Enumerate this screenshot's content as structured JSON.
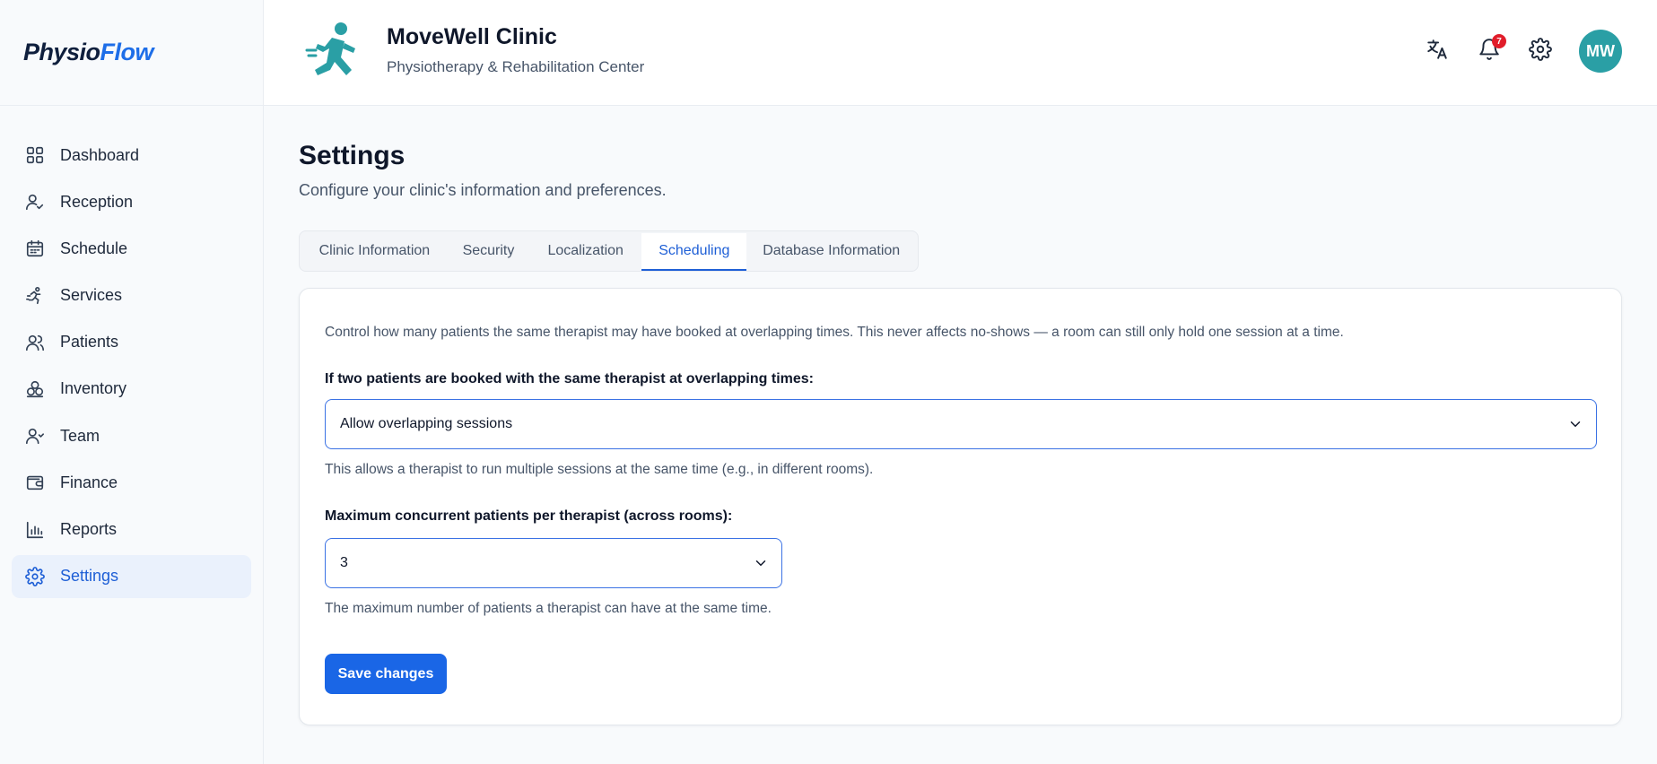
{
  "app": {
    "logo_part1": "Physio",
    "logo_part2": "Flow"
  },
  "sidebar": {
    "items": [
      {
        "label": "Dashboard",
        "icon": "grid-icon"
      },
      {
        "label": "Reception",
        "icon": "user-check-icon"
      },
      {
        "label": "Schedule",
        "icon": "calendar-icon"
      },
      {
        "label": "Services",
        "icon": "running-person-icon"
      },
      {
        "label": "Patients",
        "icon": "users-icon"
      },
      {
        "label": "Inventory",
        "icon": "boxes-icon"
      },
      {
        "label": "Team",
        "icon": "team-icon"
      },
      {
        "label": "Finance",
        "icon": "wallet-icon"
      },
      {
        "label": "Reports",
        "icon": "bar-chart-icon"
      },
      {
        "label": "Settings",
        "icon": "gear-icon",
        "active": true
      }
    ]
  },
  "header": {
    "clinic_name": "MoveWell Clinic",
    "clinic_subtitle": "Physiotherapy & Rehabilitation Center",
    "notification_count": "7",
    "avatar_initials": "MW",
    "brand_color": "#2a9fa5"
  },
  "main": {
    "title": "Settings",
    "subtitle": "Configure your clinic's information and preferences.",
    "tabs": [
      {
        "label": "Clinic Information"
      },
      {
        "label": "Security"
      },
      {
        "label": "Localization"
      },
      {
        "label": "Scheduling",
        "active": true
      },
      {
        "label": "Database Information"
      }
    ],
    "scheduling": {
      "intro": "Control how many patients the same therapist may have booked at overlapping times. This never affects no-shows — a room can still only hold one session at a time.",
      "overlap_label": "If two patients are booked with the same therapist at overlapping times:",
      "overlap_value": "Allow overlapping sessions",
      "overlap_help": "This allows a therapist to run multiple sessions at the same time (e.g., in different rooms).",
      "max_label": "Maximum concurrent patients per therapist (across rooms):",
      "max_value": "3",
      "max_help": "The maximum number of patients a therapist can have at the same time.",
      "save_label": "Save changes"
    }
  },
  "colors": {
    "accent": "#1e5fd6",
    "primary_button": "#1a66e6",
    "badge": "#e11d2a"
  }
}
